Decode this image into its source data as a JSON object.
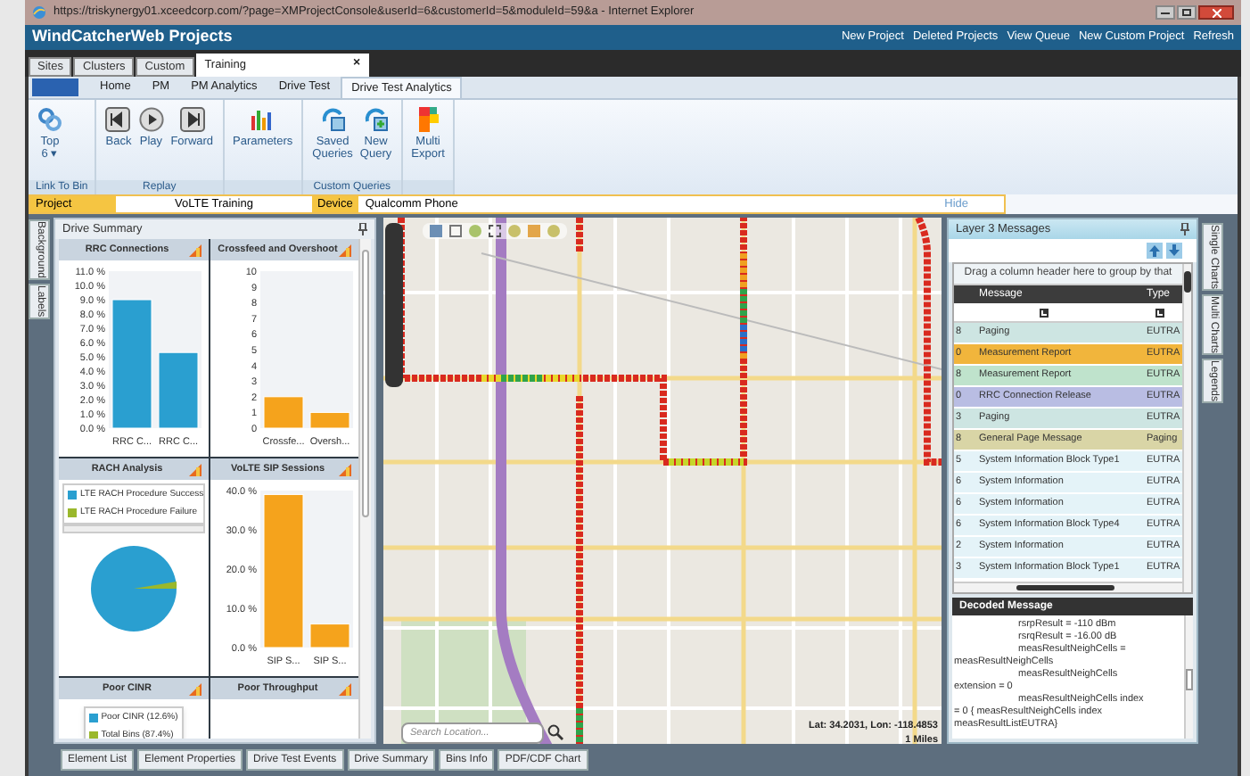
{
  "browser": {
    "title": "https://triskynergy01.xceedcorp.com/?page=XMProjectConsole&userId=6&customerId=5&moduleId=59&a - Internet Explorer"
  },
  "app": {
    "title": "WindCatcherWeb Projects",
    "links": [
      "New Project",
      "Deleted Projects",
      "View Queue",
      "New Custom Project",
      "Refresh"
    ]
  },
  "doc_tabs": [
    {
      "label": "Sites",
      "selected": false
    },
    {
      "label": "Clusters",
      "selected": false
    },
    {
      "label": "Custom",
      "selected": false
    },
    {
      "label": "Training",
      "selected": true,
      "close": "×"
    }
  ],
  "ribbon": {
    "tabs": [
      {
        "label": "Home",
        "selected": false
      },
      {
        "label": "PM",
        "selected": false
      },
      {
        "label": "PM Analytics",
        "selected": false
      },
      {
        "label": "Drive Test",
        "selected": false
      },
      {
        "label": "Drive Test Analytics",
        "selected": true
      }
    ],
    "groups": [
      {
        "label": "Link To Bin",
        "buttons": [
          {
            "lines": [
              "Top",
              "6 ▾"
            ]
          }
        ]
      },
      {
        "label": "Replay",
        "buttons": [
          {
            "lines": [
              "Back"
            ]
          },
          {
            "lines": [
              "Play"
            ]
          },
          {
            "lines": [
              "Forward"
            ]
          }
        ]
      },
      {
        "buttons": [
          {
            "lines": [
              "Parameters"
            ]
          }
        ]
      },
      {
        "label": "Custom Queries",
        "buttons": [
          {
            "lines": [
              "Saved",
              "Queries"
            ]
          },
          {
            "lines": [
              "New",
              "Query"
            ]
          }
        ]
      },
      {
        "buttons": [
          {
            "lines": [
              "Multi",
              "Export"
            ]
          }
        ]
      }
    ]
  },
  "info_bar": {
    "project_label": "Project",
    "project": "VoLTE Training",
    "device_label": "Device",
    "device": "Qualcomm Phone",
    "hide": "Hide"
  },
  "left_tabs": [
    "Background",
    "Labels"
  ],
  "drive_summary": {
    "title": "Drive Summary",
    "panels": [
      {
        "title": "RRC Connections",
        "kind": "bar",
        "chart_data": {
          "type": "bar",
          "categories": [
            "RRC C...",
            "RRC C..."
          ],
          "series": [
            {
              "color": "#2a9fd0",
              "values": [
                9.0,
                5.3
              ]
            }
          ],
          "ylim": [
            0,
            11
          ],
          "yticks": [
            {
              "value": 0,
              "label": "0.0 %"
            },
            {
              "value": 1,
              "label": "1.0 %"
            },
            {
              "value": 2,
              "label": "2.0 %"
            },
            {
              "value": 3,
              "label": "3.0 %"
            },
            {
              "value": 4,
              "label": "4.0 %"
            },
            {
              "value": 5,
              "label": "5.0 %"
            },
            {
              "value": 6,
              "label": "6.0 %"
            },
            {
              "value": 7,
              "label": "7.0 %"
            },
            {
              "value": 8,
              "label": "8.0 %"
            },
            {
              "value": 9,
              "label": "9.0 %"
            },
            {
              "value": 10,
              "label": "10.0 %"
            },
            {
              "value": 11,
              "label": "11.0 %"
            }
          ]
        }
      },
      {
        "title": "Crossfeed and Overshoot",
        "kind": "bar",
        "chart_data": {
          "type": "bar",
          "categories": [
            "Crossfe...",
            "Oversh..."
          ],
          "series": [
            {
              "color": "#f5a31c",
              "values": [
                2,
                1
              ]
            }
          ],
          "ylim": [
            0,
            10
          ],
          "yticks": [
            0,
            1,
            2,
            3,
            4,
            5,
            6,
            7,
            8,
            9,
            10
          ]
        }
      },
      {
        "title": "RACH Analysis",
        "kind": "pie",
        "legend": [
          {
            "label": "LTE RACH Procedure Success",
            "color": "#2a9fd0"
          },
          {
            "label": "LTE RACH Procedure Failure",
            "color": "#9ab82c"
          }
        ]
      },
      {
        "title": "VoLTE SIP Sessions",
        "kind": "bar",
        "chart_data": {
          "type": "bar",
          "categories": [
            "SIP S...",
            "SIP S..."
          ],
          "series": [
            {
              "color": "#f5a31c",
              "values": [
                39,
                6
              ]
            }
          ],
          "ylim": [
            0,
            40
          ],
          "yticks": [
            {
              "value": 0,
              "label": "0.0 %"
            },
            {
              "value": 10,
              "label": "10.0 %"
            },
            {
              "value": 20,
              "label": "20.0 %"
            },
            {
              "value": 30,
              "label": "30.0 %"
            },
            {
              "value": 40,
              "label": "40.0 %"
            }
          ]
        }
      },
      {
        "title": "Poor CINR",
        "kind": "legend",
        "legend": [
          {
            "label": "Poor CINR (12.6%)",
            "color": "#2a9fd0"
          },
          {
            "label": "Total Bins (87.4%)",
            "color": "#9ab82c"
          }
        ]
      },
      {
        "title": "Poor Throughput",
        "kind": "empty"
      }
    ]
  },
  "map": {
    "search_placeholder": "Search Location...",
    "coordinates": "Lat: 34.2031, Lon: -118.4853",
    "scale": "1 Miles"
  },
  "layer3": {
    "title": "Layer 3 Messages",
    "group_hint": "Drag a column header here to group by that",
    "columns": [
      "Message",
      "Type"
    ],
    "rows": [
      {
        "column_1": "8",
        "message": "Paging",
        "type": "EUTRA",
        "color": "#cde5e2"
      },
      {
        "column_1": "0",
        "message": "Measurement Report",
        "type": "EUTRA",
        "color": "#f1b53c"
      },
      {
        "column_1": "8",
        "message": "Measurement Report",
        "type": "EUTRA",
        "color": "#bfe3cc"
      },
      {
        "column_1": "0",
        "message": "RRC Connection Release",
        "type": "EUTRA",
        "color": "#b9bde3"
      },
      {
        "column_1": "3",
        "message": "Paging",
        "type": "EUTRA",
        "color": "#cde5e2"
      },
      {
        "column_1": "8",
        "message": "General Page Message",
        "type": "Paging",
        "color": "#d9d5a6"
      },
      {
        "column_1": "5",
        "message": "System Information Block Type1",
        "type": "EUTRA",
        "color": "#e4f3f8"
      },
      {
        "column_1": "6",
        "message": "System Information",
        "type": "EUTRA",
        "color": "#e4f3f8"
      },
      {
        "column_1": "6",
        "message": "System Information",
        "type": "EUTRA",
        "color": "#e4f3f8"
      },
      {
        "column_1": "6",
        "message": "System Information Block Type4",
        "type": "EUTRA",
        "color": "#e4f3f8"
      },
      {
        "column_1": "2",
        "message": "System Information",
        "type": "EUTRA",
        "color": "#e4f3f8"
      },
      {
        "column_1": "3",
        "message": "System Information Block Type1",
        "type": "EUTRA",
        "color": "#e4f3f8"
      }
    ]
  },
  "decoded": {
    "title": "Decoded Message",
    "lines": [
      {
        "kind": "indented",
        "text": "rsrpResult = -110 dBm"
      },
      {
        "kind": "indented",
        "text": "rsrqResult = -16.00 dB"
      },
      {
        "kind": "indented",
        "text": "measResultNeighCells ="
      },
      {
        "kind": "plain",
        "text": "measResultNeighCells"
      },
      {
        "kind": "indented",
        "text": "measResultNeighCells"
      },
      {
        "kind": "plain",
        "text": "extension = 0"
      },
      {
        "kind": "indented",
        "text": "measResultNeighCells index"
      },
      {
        "kind": "plain",
        "text": "= 0 { measResultNeighCells index"
      },
      {
        "kind": "plain",
        "text": "measResultListEUTRA}"
      }
    ]
  },
  "right_tabs": [
    "Single Charts",
    "Multi Charts",
    "Legends"
  ],
  "bottom_tabs": [
    "Element List",
    "Element Properties",
    "Drive Test Events",
    "Drive Summary",
    "Bins Info",
    "PDF/CDF Chart"
  ]
}
